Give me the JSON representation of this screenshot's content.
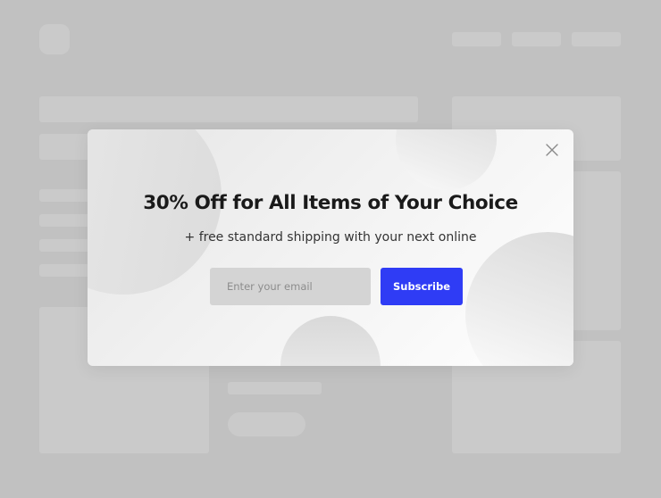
{
  "popup": {
    "title": "30% Off for All Items of Your Choice",
    "subtitle": "+ free standard shipping with your next online",
    "email_placeholder": "Enter your email",
    "subscribe_label": "Subscribe",
    "close_icon": "close-icon"
  },
  "colors": {
    "overlay_background": "#c1c1c1",
    "skeleton_block": "#cacaca",
    "accent_button": "#2f3cf5",
    "input_background": "#d4d4d4",
    "title_text": "#1a1a1a"
  }
}
